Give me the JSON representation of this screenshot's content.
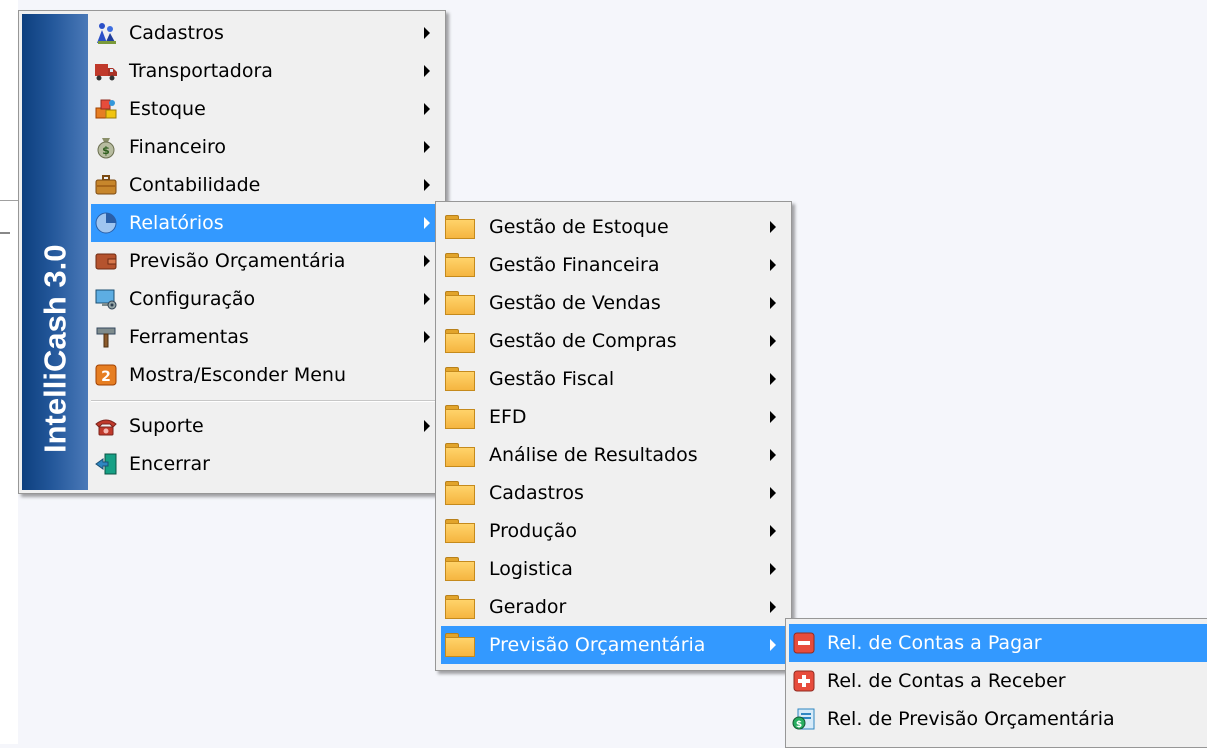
{
  "banner": {
    "text": "IntelliCash 3.0"
  },
  "main_menu": {
    "items": [
      {
        "label": "Cadastros",
        "icon": "people-icon"
      },
      {
        "label": "Transportadora",
        "icon": "truck-icon"
      },
      {
        "label": "Estoque",
        "icon": "boxes-icon"
      },
      {
        "label": "Financeiro",
        "icon": "money-bag-icon"
      },
      {
        "label": "Contabilidade",
        "icon": "briefcase-icon"
      },
      {
        "label": "Relatórios",
        "icon": "pie-chart-icon"
      },
      {
        "label": "Previsão Orçamentária",
        "icon": "wallet-icon"
      },
      {
        "label": "Configuração",
        "icon": "computer-settings-icon"
      },
      {
        "label": "Ferramentas",
        "icon": "hammer-icon"
      },
      {
        "label": "Mostra/Esconder Menu",
        "icon": "toggle-menu-icon"
      },
      {
        "label": "Suporte",
        "icon": "telephone-icon"
      },
      {
        "label": "Encerrar",
        "icon": "exit-door-icon"
      }
    ]
  },
  "submenu_relatorios": {
    "items": [
      {
        "label": "Gestão de Estoque"
      },
      {
        "label": "Gestão Financeira"
      },
      {
        "label": "Gestão de Vendas"
      },
      {
        "label": "Gestão de Compras"
      },
      {
        "label": "Gestão Fiscal"
      },
      {
        "label": "EFD"
      },
      {
        "label": "Análise de Resultados"
      },
      {
        "label": "Cadastros"
      },
      {
        "label": "Produção"
      },
      {
        "label": "Logistica"
      },
      {
        "label": "Gerador"
      },
      {
        "label": "Previsão Orçamentária"
      }
    ]
  },
  "submenu_previsao": {
    "items": [
      {
        "label": "Rel. de Contas a Pagar",
        "icon": "minus-red-icon"
      },
      {
        "label": "Rel. de Contas a Receber",
        "icon": "plus-red-icon"
      },
      {
        "label": "Rel. de Previsão Orçamentária",
        "icon": "money-report-icon"
      }
    ]
  },
  "colors": {
    "highlight": "#3399ff",
    "menu_bg": "#f0f0f0",
    "banner_dark": "#0d3f7e",
    "banner_light": "#4a79b8",
    "folder": "#f5b540"
  }
}
